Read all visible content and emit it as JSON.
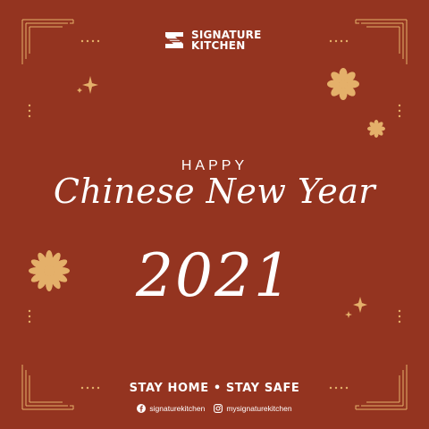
{
  "brand": {
    "name_line1": "SIGNATURE",
    "name_line2": "KITCHEN"
  },
  "greeting": {
    "happy": "HAPPY",
    "title": "Chinese New Year",
    "year": "2021"
  },
  "footer": {
    "slogan": "STAY HOME • STAY SAFE",
    "facebook": "signaturekitchen",
    "instagram": "mysignaturekitchen"
  },
  "icons": [
    "brand-logo-icon",
    "facebook-icon",
    "instagram-icon",
    "flower-icon",
    "sparkle-icon"
  ],
  "colors": {
    "background": "#943420",
    "gold": "#e4b06a",
    "text": "#ffffff"
  }
}
